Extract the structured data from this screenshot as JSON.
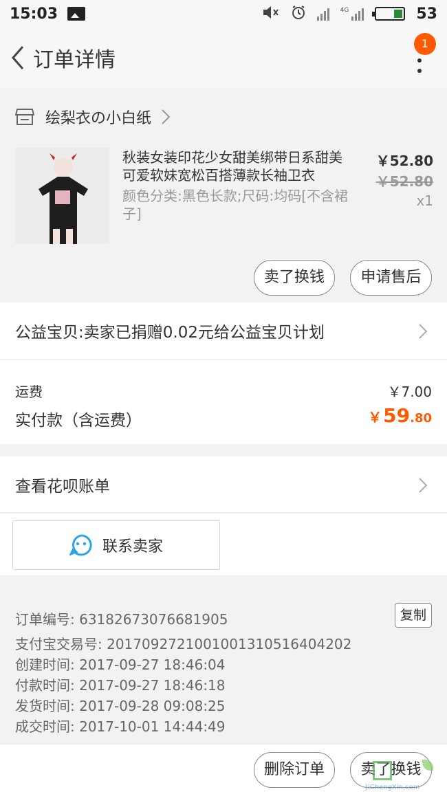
{
  "status_bar": {
    "time": "15:03",
    "battery_level": "53",
    "network": "4G"
  },
  "header": {
    "title": "订单详情",
    "badge_count": "1"
  },
  "shop": {
    "name": "绘梨衣の小白纸"
  },
  "product": {
    "name": "秋装女装印花少女甜美绑带日系甜美可爱软妹宽松百搭薄款长袖卫衣",
    "spec": "颜色分类:黑色长款;尺码:均码[不含裙子]",
    "price": "￥52.80",
    "original_price": "￥52.80",
    "quantity": "x1"
  },
  "product_actions": {
    "exchange_label": "卖了换钱",
    "aftersale_label": "申请售后"
  },
  "charity": {
    "text": "公益宝贝:卖家已捐赠0.02元给公益宝贝计划"
  },
  "fees": {
    "shipping_label": "运费",
    "shipping_value": "￥7.00",
    "paid_label": "实付款（含运费）",
    "paid_currency": "￥",
    "paid_int": "59",
    "paid_dec": ".80"
  },
  "huabei": {
    "label": "查看花呗账单"
  },
  "contact": {
    "label": "联系卖家"
  },
  "order_info": {
    "order_no": "订单编号: 63182673076681905",
    "copy_label": "复制",
    "alipay_no": "支付宝交易号: 2017092721001001310516404202",
    "created": "创建时间: 2017-09-27 18:46:04",
    "paid": "付款时间: 2017-09-27 18:46:18",
    "shipped": "发货时间: 2017-09-28 09:08:25",
    "completed": "成交时间: 2017-10-01 14:44:49"
  },
  "bottom_actions": {
    "delete_label": "删除订单",
    "exchange_label": "卖了换钱"
  },
  "watermark": {
    "text": "JiChengXin.com"
  },
  "colors": {
    "accent": "#ff5a00",
    "background": "#f2f2f2",
    "panel": "#ffffff",
    "contact_icon": "#2aa6e8"
  }
}
